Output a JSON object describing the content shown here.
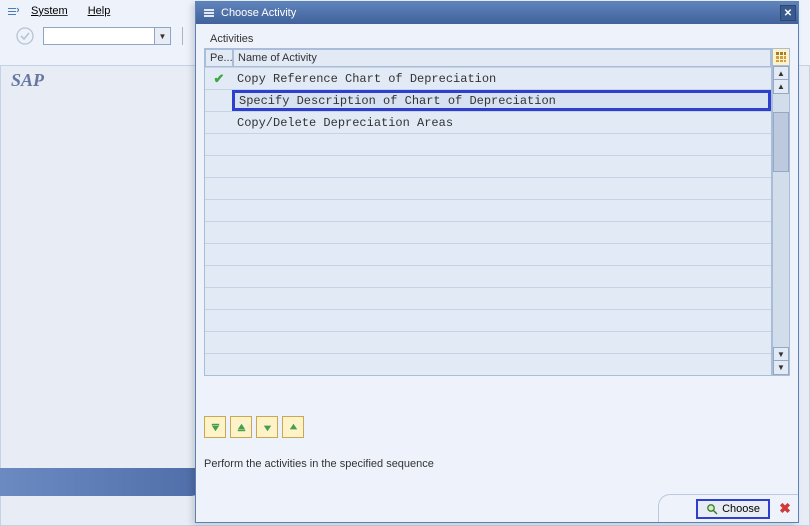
{
  "menu": {
    "system": "System",
    "help": "Help"
  },
  "main": {
    "logo": "SAP"
  },
  "dialog": {
    "title": "Choose Activity",
    "section_header": "Activities",
    "columns": {
      "pe": "Pe...",
      "name": "Name of Activity"
    },
    "rows": [
      {
        "status": "done",
        "name": "Copy Reference Chart of Depreciation"
      },
      {
        "status": "",
        "name": "Specify Description of Chart of Depreciation"
      },
      {
        "status": "",
        "name": "Copy/Delete Depreciation Areas"
      }
    ],
    "help_text": "Perform the activities in the specified sequence",
    "choose_label": "Choose"
  }
}
